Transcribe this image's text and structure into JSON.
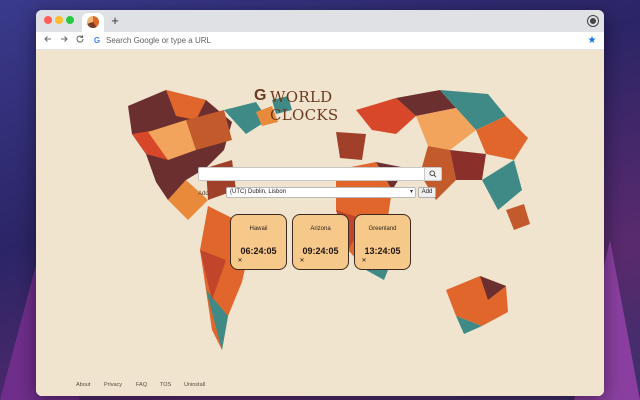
{
  "browser": {
    "new_tab_symbol": "+",
    "omnibox_placeholder": "Search Google or type a URL",
    "nav_back_icon": "arrow-left-icon",
    "nav_forward_icon": "arrow-right-icon",
    "reload_icon": "reload-icon",
    "bookmark_icon": "star-icon"
  },
  "app": {
    "logo_text": "WORLD CLOCKS",
    "search_value": "",
    "add_label": "Add",
    "timezone_selected": "(UTC) Dublin, Lisbon",
    "add_button": "Add"
  },
  "clocks": [
    {
      "name": "Hawaii",
      "time": "06:24:05",
      "remove": "✕"
    },
    {
      "name": "Arizona",
      "time": "09:24:05",
      "remove": "✕"
    },
    {
      "name": "Greenland",
      "time": "13:24:05",
      "remove": "✕"
    }
  ],
  "footer": {
    "links": [
      "About",
      "Privacy",
      "FAQ",
      "TOS",
      "Uninstall"
    ]
  },
  "colors": {
    "card_bg": "#f6c88a",
    "page_bg": "#f0e4cf",
    "map_orange": "#e0662c",
    "map_teal": "#3f8a86",
    "map_brown": "#6b2f2f"
  }
}
